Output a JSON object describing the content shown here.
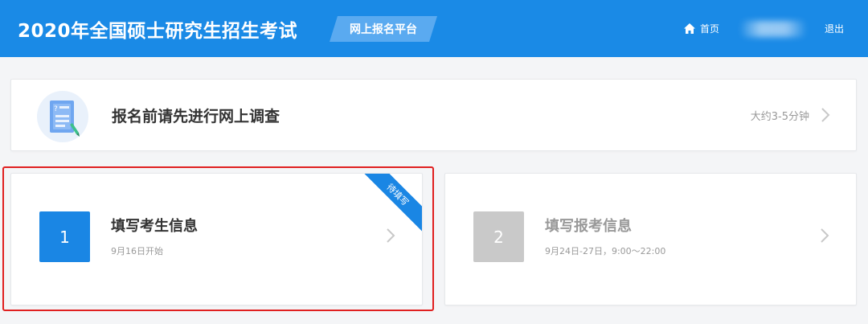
{
  "header": {
    "title": "2020年全国硕士研究生招生考试",
    "platform_tag": "网上报名平台",
    "home_label": "首页",
    "home_icon": "home-icon",
    "username": "",
    "logout_label": "退出",
    "bg_color": "#1a8ae6"
  },
  "survey": {
    "title": "报名前请先进行网上调查",
    "duration": "大约3-5分钟",
    "icon": "survey-document-icon"
  },
  "steps": [
    {
      "number": "1",
      "title": "填写考生信息",
      "subtitle": "9月16日开始",
      "ribbon": "待填写",
      "accent": "#1a86e4",
      "state": "active"
    },
    {
      "number": "2",
      "title": "填写报考信息",
      "subtitle": "9月24日-27日，9:00～22:00",
      "accent": "#c9c9c9",
      "state": "disabled"
    }
  ],
  "highlight_color": "#e02020"
}
